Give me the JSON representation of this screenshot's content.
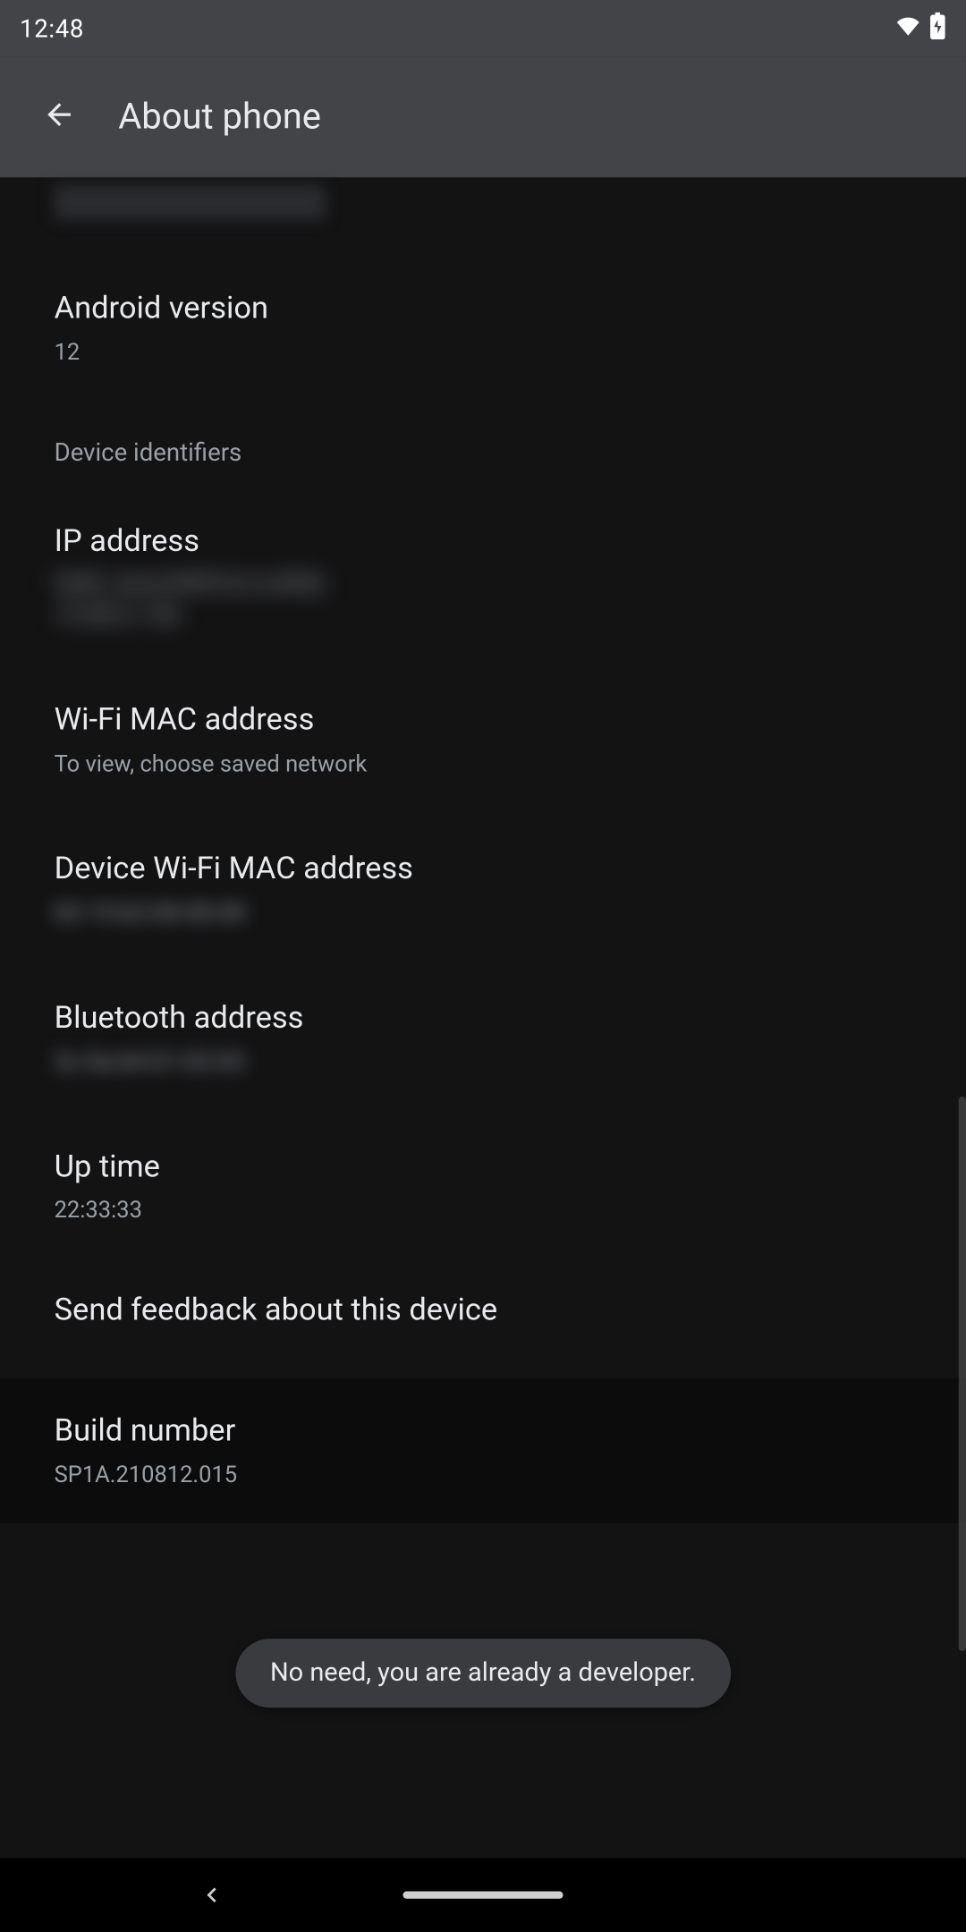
{
  "status": {
    "time": "12:48"
  },
  "appbar": {
    "title": "About phone"
  },
  "android_version": {
    "label": "Android version",
    "value": "12"
  },
  "section_device_identifiers": "Device identifiers",
  "ip_address": {
    "label": "IP address",
    "line1": "fe80::a4cd:89ff:fe1e:8f4b",
    "line2": "10.88.0.106"
  },
  "wifi_mac": {
    "label": "Wi-Fi MAC address",
    "value": "To view, choose saved network"
  },
  "device_wifi_mac": {
    "label": "Device Wi-Fi MAC address",
    "value": "02:15:b2:00:00:00"
  },
  "bluetooth_address": {
    "label": "Bluetooth address",
    "value": "3c:5a:b4:01:02:03"
  },
  "uptime": {
    "label": "Up time",
    "value": "22:33:33"
  },
  "send_feedback": {
    "label": "Send feedback about this device"
  },
  "build_number": {
    "label": "Build number",
    "value": "SP1A.210812.015"
  },
  "toast": "No need, you are already a developer."
}
